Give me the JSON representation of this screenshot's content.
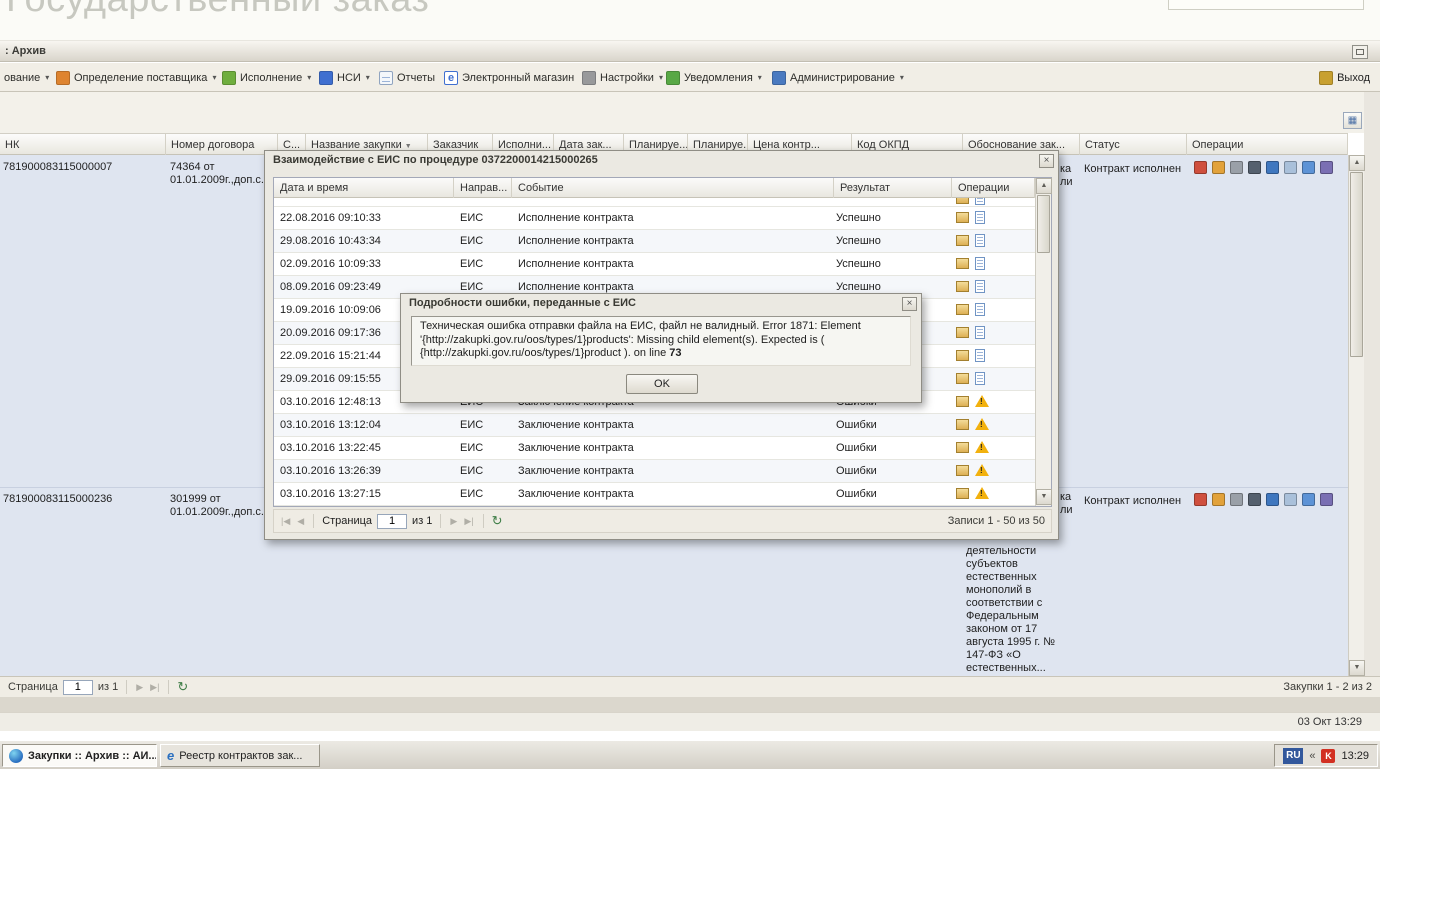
{
  "banner": {
    "title": "Государственный заказ"
  },
  "window": {
    "title": ": Архив",
    "status_datetime": "03 Окт 13:29"
  },
  "menubar": {
    "items": [
      {
        "label": "ование",
        "icon": "planning-icon",
        "dropdown": true
      },
      {
        "label": "Определение поставщика",
        "icon": "supplier-icon",
        "dropdown": true
      },
      {
        "label": "Исполнение",
        "icon": "execution-icon",
        "dropdown": true
      },
      {
        "label": "НСИ",
        "icon": "nsi-icon",
        "dropdown": true
      },
      {
        "label": "Отчеты",
        "icon": "reports-icon",
        "dropdown": false
      },
      {
        "label": "Электронный магазин",
        "icon": "eshop-icon",
        "dropdown": false
      },
      {
        "label": "Настройки",
        "icon": "settings-icon",
        "dropdown": true
      },
      {
        "label": "Уведомления",
        "icon": "notifications-icon",
        "dropdown": true
      },
      {
        "label": "Администрирование",
        "icon": "admin-icon",
        "dropdown": true
      }
    ],
    "exit_label": "Выход"
  },
  "grid": {
    "columns": [
      "НК",
      "Номер договора",
      "С...",
      "Название закупки",
      "Заказчик",
      "Исполни...",
      "Дата зак...",
      "Планируе...",
      "Планируе...",
      "Цена контр...",
      "Код ОКПД",
      "Обоснование зак...",
      "Статус",
      "Операции"
    ],
    "rows": [
      {
        "nk": "781900083115000007",
        "contract_line1": "74364 от",
        "contract_line2": "01.01.2009г.,доп.с...",
        "status": "Контракт исполнен",
        "justification_fragment1": "ка",
        "justification_fragment2": "ли",
        "justification": ""
      },
      {
        "nk": "781900083115000236",
        "contract_line1": "301999 от",
        "contract_line2": "01.01.2009г.,доп.с...",
        "status": "Контракт исполнен",
        "justification_fragment1": "ка",
        "justification_fragment2": "ли",
        "justification": "деятельности субъектов естественных монополий в соответствии с Федеральным законом от 17 августа 1995 г. № 147-ФЗ «О естественных..."
      }
    ],
    "pagination": {
      "page_label": "Страница",
      "page_value": "1",
      "of_label": "из 1",
      "records": "Закупки 1 - 2 из 2"
    }
  },
  "operations_icons": [
    "document-icon",
    "award-icon",
    "gear-icon",
    "printer-icon",
    "chart-icon",
    "file-icon",
    "columns-icon",
    "monitor-icon"
  ],
  "eis_dialog": {
    "title": "Взаимодействие с ЕИС по процедуре 0372200014215000265",
    "columns": [
      "Дата и время",
      "Направ...",
      "Событие",
      "Результат",
      "Операции"
    ],
    "rows": [
      {
        "datetime": "22.08.2016 09:10:33",
        "direction": "ЕИС",
        "event": "Исполнение контракта",
        "result": "Успешно",
        "icons": [
          "box-icon",
          "document-icon"
        ]
      },
      {
        "datetime": "29.08.2016 10:43:34",
        "direction": "ЕИС",
        "event": "Исполнение контракта",
        "result": "Успешно",
        "icons": [
          "box-icon",
          "document-icon"
        ]
      },
      {
        "datetime": "02.09.2016 10:09:33",
        "direction": "ЕИС",
        "event": "Исполнение контракта",
        "result": "Успешно",
        "icons": [
          "box-icon",
          "document-icon"
        ]
      },
      {
        "datetime": "08.09.2016 09:23:49",
        "direction": "ЕИС",
        "event": "Исполнение контракта",
        "result": "Успешно",
        "icons": [
          "box-icon",
          "document-icon"
        ]
      },
      {
        "datetime": "19.09.2016 10:09:06",
        "direction": "",
        "event": "",
        "result": "",
        "icons": [
          "box-icon",
          "document-icon"
        ]
      },
      {
        "datetime": "20.09.2016 09:17:36",
        "direction": "",
        "event": "",
        "result": "",
        "icons": [
          "box-icon",
          "document-icon"
        ]
      },
      {
        "datetime": "22.09.2016 15:21:44",
        "direction": "",
        "event": "",
        "result": "",
        "icons": [
          "box-icon",
          "document-icon"
        ]
      },
      {
        "datetime": "29.09.2016 09:15:55",
        "direction": "",
        "event": "",
        "result": "",
        "icons": [
          "box-icon",
          "document-icon"
        ]
      },
      {
        "datetime": "03.10.2016 12:48:13",
        "direction": "ЕИС",
        "event": "Заключение контракта",
        "result": "Ошибки",
        "icons": [
          "box-icon",
          "warning-icon"
        ]
      },
      {
        "datetime": "03.10.2016 13:12:04",
        "direction": "ЕИС",
        "event": "Заключение контракта",
        "result": "Ошибки",
        "icons": [
          "box-icon",
          "warning-icon"
        ]
      },
      {
        "datetime": "03.10.2016 13:22:45",
        "direction": "ЕИС",
        "event": "Заключение контракта",
        "result": "Ошибки",
        "icons": [
          "box-icon",
          "warning-icon"
        ]
      },
      {
        "datetime": "03.10.2016 13:26:39",
        "direction": "ЕИС",
        "event": "Заключение контракта",
        "result": "Ошибки",
        "icons": [
          "box-icon",
          "warning-icon"
        ]
      },
      {
        "datetime": "03.10.2016 13:27:15",
        "direction": "ЕИС",
        "event": "Заключение контракта",
        "result": "Ошибки",
        "icons": [
          "box-icon",
          "warning-icon"
        ]
      }
    ],
    "pagination": {
      "page_label": "Страница",
      "page_value": "1",
      "of_label": "из 1",
      "records": "Записи 1 - 50 из 50"
    }
  },
  "error_dialog": {
    "title": "Подробности ошибки, переданные с ЕИС",
    "message_before": "Техническая ошибка отправки файла на ЕИС, файл не валидный. Error 1871: Element '{http://zakupki.gov.ru/oos/types/1}products': Missing child element(s). Expected is ( {http://zakupki.gov.ru/oos/types/1}product ). on line ",
    "line_number": "73",
    "ok_label": "OK"
  },
  "taskbar": {
    "buttons": [
      {
        "label": "Закупки :: Архив :: АИ...",
        "icon": "browser-icon",
        "active": true
      },
      {
        "label": "Реестр контрактов зак...",
        "icon": "ie-icon",
        "active": false
      }
    ],
    "tray": {
      "lang": "RU",
      "chevron": "«",
      "time": "13:29"
    }
  }
}
